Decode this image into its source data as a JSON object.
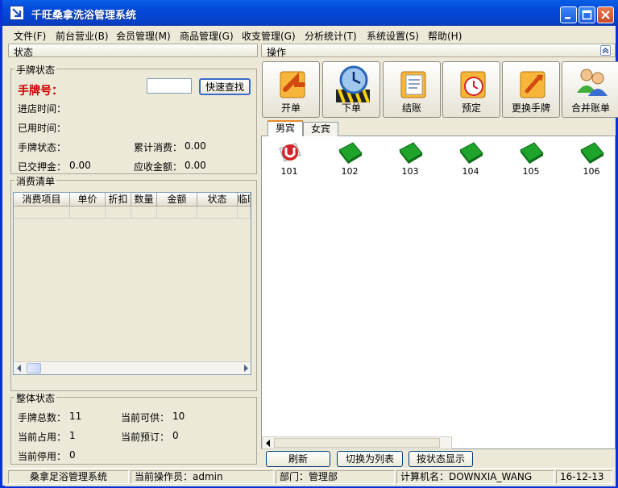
{
  "window": {
    "title": "千旺桑拿洗浴管理系统"
  },
  "menu": [
    "文件(F)",
    "前台营业(B)",
    "会员管理(M)",
    "商品管理(G)",
    "收支管理(G)",
    "分析统计(T)",
    "系统设置(S)",
    "帮助(H)"
  ],
  "left": {
    "header": "状态",
    "tag": {
      "title": "手牌状态",
      "number_label": "手牌号：",
      "number_value": "",
      "search_button": "快速查找",
      "enter_time_label": "进店时间：",
      "used_time_label": "已用时间：",
      "status_label": "手牌状态：",
      "total_consume_label": "累计消费：",
      "total_consume_value": "0.00",
      "deposit_label": "已交押金：",
      "deposit_value": "0.00",
      "receivable_label": "应收金额：",
      "receivable_value": "0.00"
    },
    "consume": {
      "title": "消费清单",
      "columns": [
        "消费项目",
        "单价",
        "折扣",
        "数量",
        "金额",
        "状态",
        "临时"
      ]
    },
    "overall": {
      "title": "整体状态",
      "total_label": "手牌总数：",
      "total_value": "11",
      "available_label": "当前可供：",
      "available_value": "10",
      "occupied_label": "当前占用：",
      "occupied_value": "1",
      "reserved_label": "当前预订：",
      "reserved_value": "0",
      "stopped_label": "当前停用：",
      "stopped_value": "0"
    }
  },
  "right": {
    "header": "操作",
    "tools": [
      {
        "label": "开单",
        "icon": "open-order-icon"
      },
      {
        "label": "下单",
        "icon": "clock-order-icon"
      },
      {
        "label": "结账",
        "icon": "checkout-icon"
      },
      {
        "label": "预定",
        "icon": "reserve-icon"
      },
      {
        "label": "更换手牌",
        "icon": "change-tag-icon"
      },
      {
        "label": "合并账单",
        "icon": "merge-bill-icon"
      }
    ],
    "tabs": [
      "男宾",
      "女宾"
    ],
    "rooms": [
      {
        "number": "101",
        "status": "occupied"
      },
      {
        "number": "102",
        "status": "available"
      },
      {
        "number": "103",
        "status": "available"
      },
      {
        "number": "104",
        "status": "available"
      },
      {
        "number": "105",
        "status": "available"
      },
      {
        "number": "106",
        "status": "available"
      }
    ],
    "buttons": {
      "refresh": "刷新",
      "list_view": "切换为列表",
      "status_view": "按状态显示"
    }
  },
  "status_bar": {
    "system": "桑拿足浴管理系统",
    "operator": "当前操作员：admin",
    "department": "部门：管理部",
    "computer": "计算机名：DOWNXIA_WANG",
    "date": "16-12-13"
  },
  "colors": {
    "title_blue": "#0449d8",
    "room_available": "#1fa42b",
    "room_occupied": "#d2232a",
    "label_red": "#cc0000"
  }
}
